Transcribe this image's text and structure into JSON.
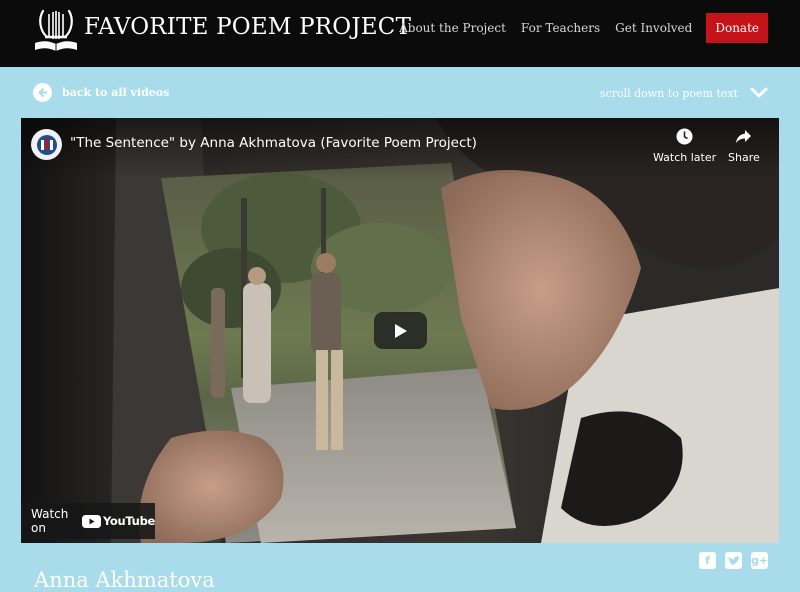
{
  "site": {
    "title": "FAVORITE POEM PROJECT",
    "logo_icon": "lyre-book-icon"
  },
  "nav": {
    "items": [
      {
        "label": "About the Project"
      },
      {
        "label": "For Teachers"
      },
      {
        "label": "Get Involved"
      }
    ],
    "donate_label": "Donate",
    "donate_color": "#c4141a"
  },
  "subnav": {
    "back_label": "back to all videos",
    "back_icon": "arrow-left-icon",
    "scroll_label": "scroll down to poem text",
    "scroll_icon": "chevron-down-icon"
  },
  "video": {
    "title": "\"The Sentence\" by Anna Akhmatova (Favorite Poem Project)",
    "watch_later_label": "Watch later",
    "share_label": "Share",
    "watch_on_label": "Watch on",
    "youtube_label": "YouTube"
  },
  "social": {
    "icons": [
      "facebook-icon",
      "twitter-icon",
      "google-plus-icon"
    ]
  },
  "poem": {
    "author": "Anna Akhmatova"
  },
  "colors": {
    "background": "#a9dceb",
    "header": "#0b0b0b"
  }
}
